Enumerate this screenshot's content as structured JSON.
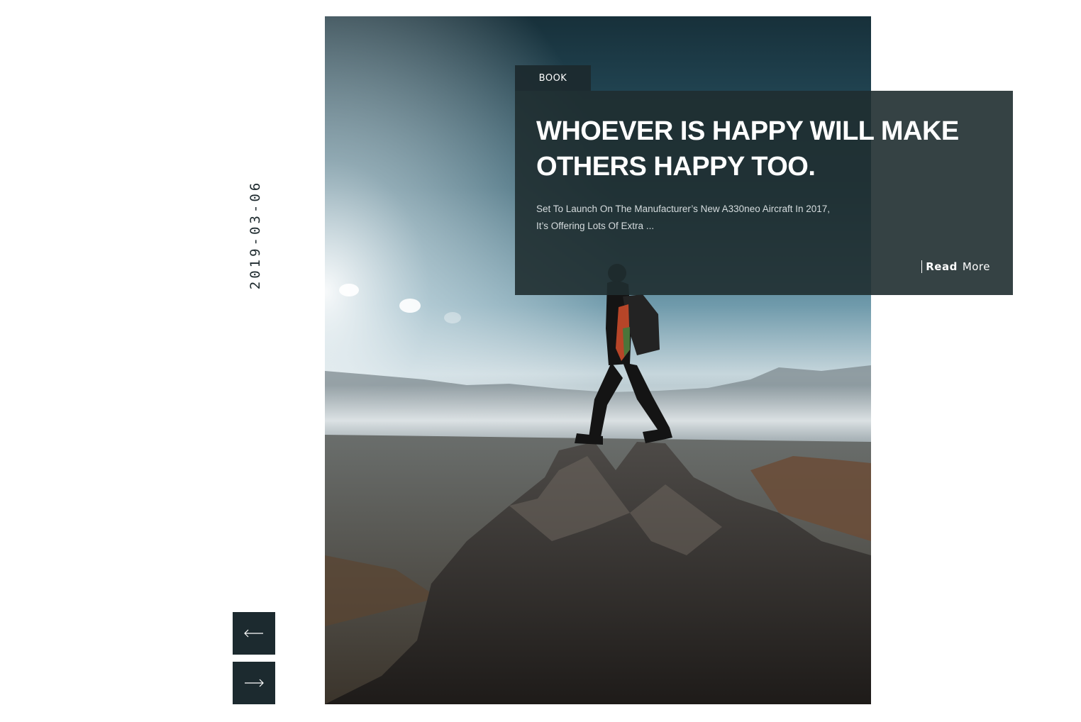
{
  "post": {
    "date": "2019-03-06",
    "category": "BOOK",
    "title": "WHOEVER IS HAPPY WILL MAKE OTHERS HAPPY TOO.",
    "excerpt": "Set To Launch On The Manufacturer’s New A330neo Aircraft In 2017, It’s Offering Lots Of Extra ...",
    "read_more_bold": "Read",
    "read_more_rest": "More"
  },
  "slider": {
    "prev_icon": "arrow-left-icon",
    "next_icon": "arrow-right-icon"
  },
  "colors": {
    "dark": "#1c2a2f",
    "card": "#1f2d30"
  }
}
